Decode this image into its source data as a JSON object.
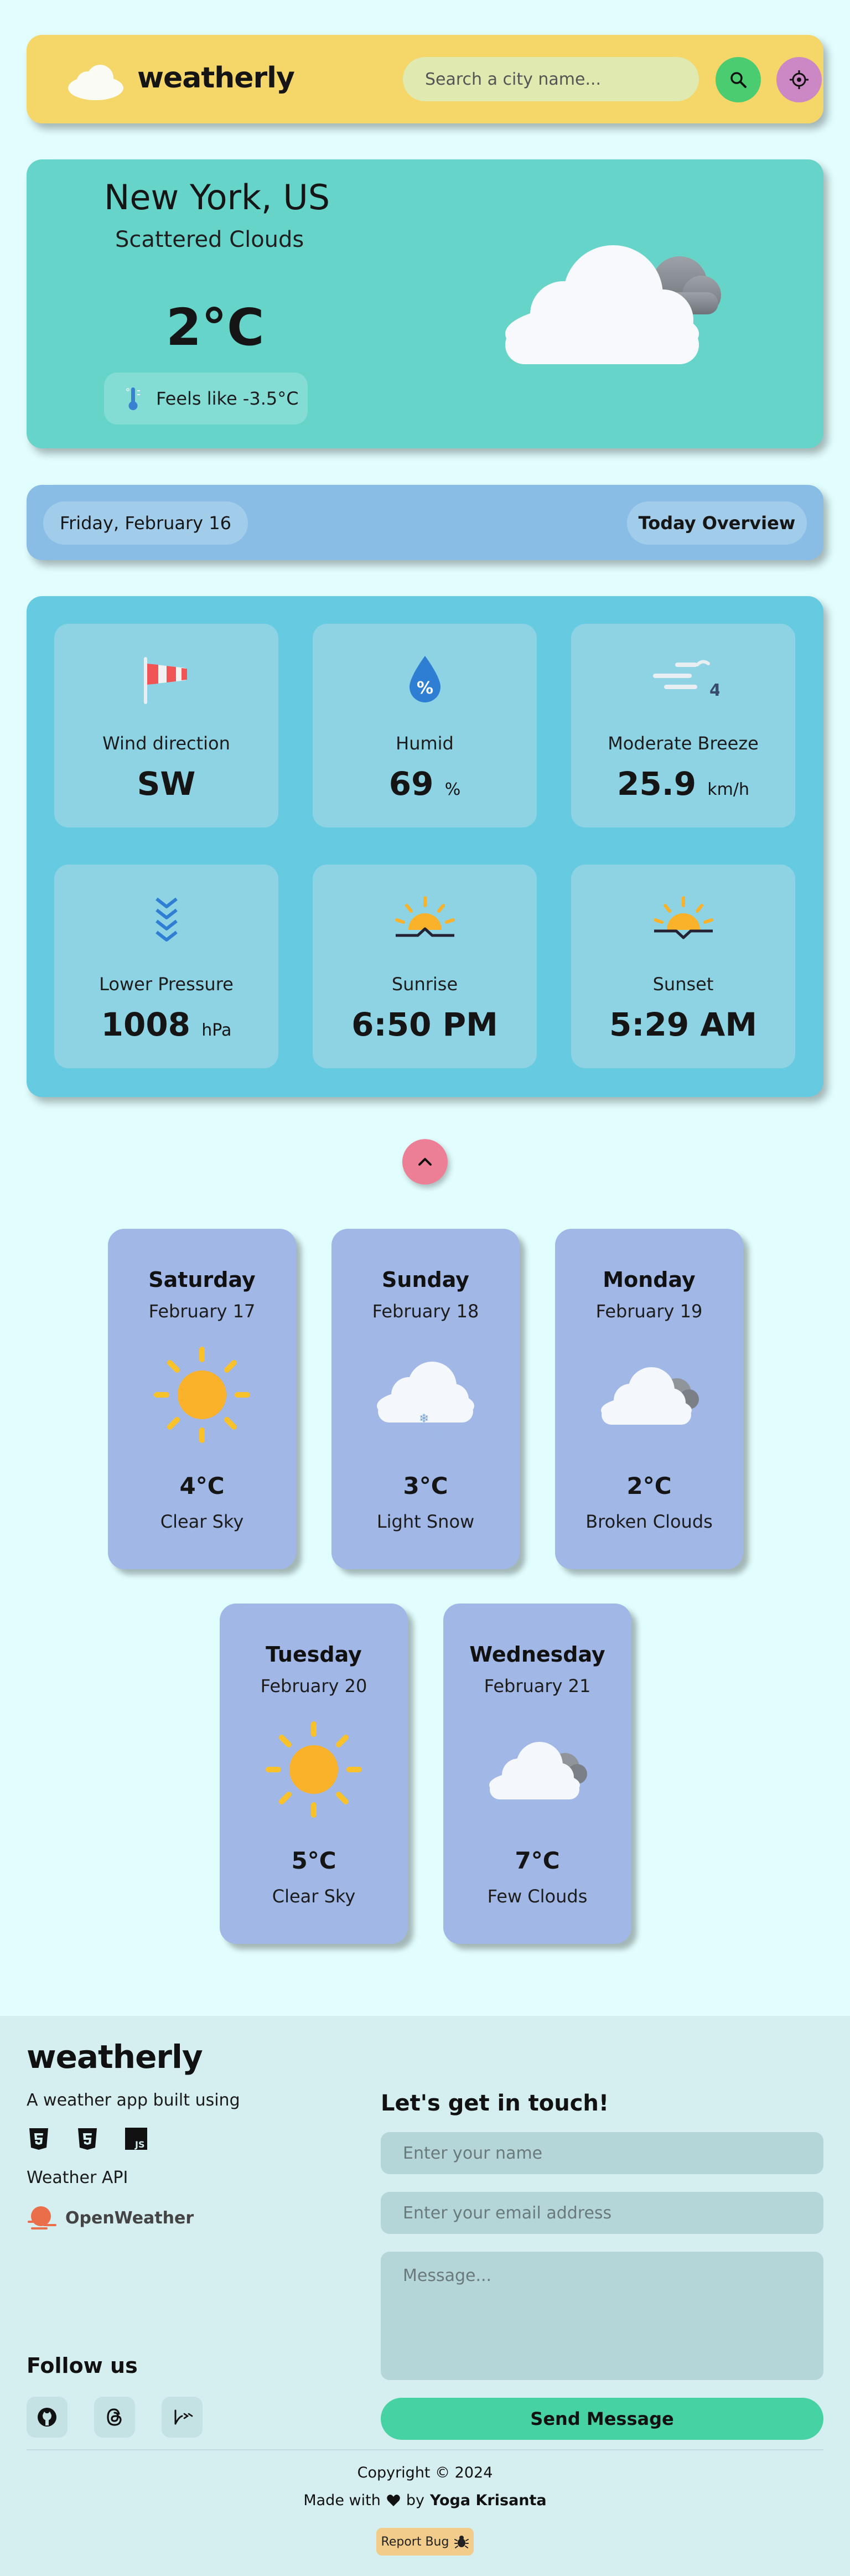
{
  "header": {
    "brand": "weatherly",
    "search_placeholder": "Search a city name...",
    "icons": {
      "logo": "cloud-icon",
      "search": "search-icon",
      "locate": "crosshair-icon"
    },
    "colors": {
      "bar": "#f5d668",
      "search_btn": "#4ccc70",
      "locate_btn": "#cc88c4"
    }
  },
  "current": {
    "city": "New York, US",
    "condition": "Scattered Clouds",
    "temperature": "2°C",
    "feels_like": "Feels like -3.5°C",
    "icon": "scattered-clouds-icon"
  },
  "date_bar": {
    "date": "Friday, February 16",
    "overview": "Today Overview"
  },
  "highlights": [
    {
      "label": "Wind direction",
      "value": "SW",
      "unit": "",
      "icon": "windsock-icon"
    },
    {
      "label": "Humid",
      "value": "69",
      "unit": "%",
      "icon": "humidity-icon"
    },
    {
      "label": "Moderate Breeze",
      "value": "25.9",
      "unit": "km/h",
      "icon": "wind-speed-icon",
      "badge": "4"
    },
    {
      "label": "Lower Pressure",
      "value": "1008",
      "unit": "hPa",
      "icon": "pressure-down-icon"
    },
    {
      "label": "Sunrise",
      "value": "6:50 PM",
      "unit": "",
      "icon": "sunrise-icon"
    },
    {
      "label": "Sunset",
      "value": "5:29 AM",
      "unit": "",
      "icon": "sunset-icon"
    }
  ],
  "forecast": [
    {
      "day": "Saturday",
      "date": "February 17",
      "temp": "4°C",
      "desc": "Clear Sky",
      "icon": "sun-icon"
    },
    {
      "day": "Sunday",
      "date": "February 18",
      "temp": "3°C",
      "desc": "Light Snow",
      "icon": "snow-cloud-icon"
    },
    {
      "day": "Monday",
      "date": "February 19",
      "temp": "2°C",
      "desc": "Broken Clouds",
      "icon": "broken-clouds-icon"
    },
    {
      "day": "Tuesday",
      "date": "February 20",
      "temp": "5°C",
      "desc": "Clear Sky",
      "icon": "sun-icon"
    },
    {
      "day": "Wednesday",
      "date": "February 21",
      "temp": "7°C",
      "desc": "Few Clouds",
      "icon": "few-clouds-icon"
    }
  ],
  "footer": {
    "brand": "weatherly",
    "built_using": "A weather app built using",
    "tech_icons": [
      "html5-icon",
      "css3-icon",
      "javascript-icon"
    ],
    "api_label": "Weather API",
    "api_name": "OpenWeather",
    "follow_us": "Follow us",
    "social_icons": [
      "github-icon",
      "threads-icon",
      "bluesky-icon"
    ],
    "contact_title": "Let's get in touch!",
    "name_placeholder": "Enter your name",
    "email_placeholder": "Enter your email address",
    "message_placeholder": "Message...",
    "send_label": "Send Message",
    "copyright": "Copyright © 2024",
    "made_with": "Made with",
    "by": "by",
    "author": "Yoga Krisanta",
    "report_bug": "Report Bug"
  }
}
